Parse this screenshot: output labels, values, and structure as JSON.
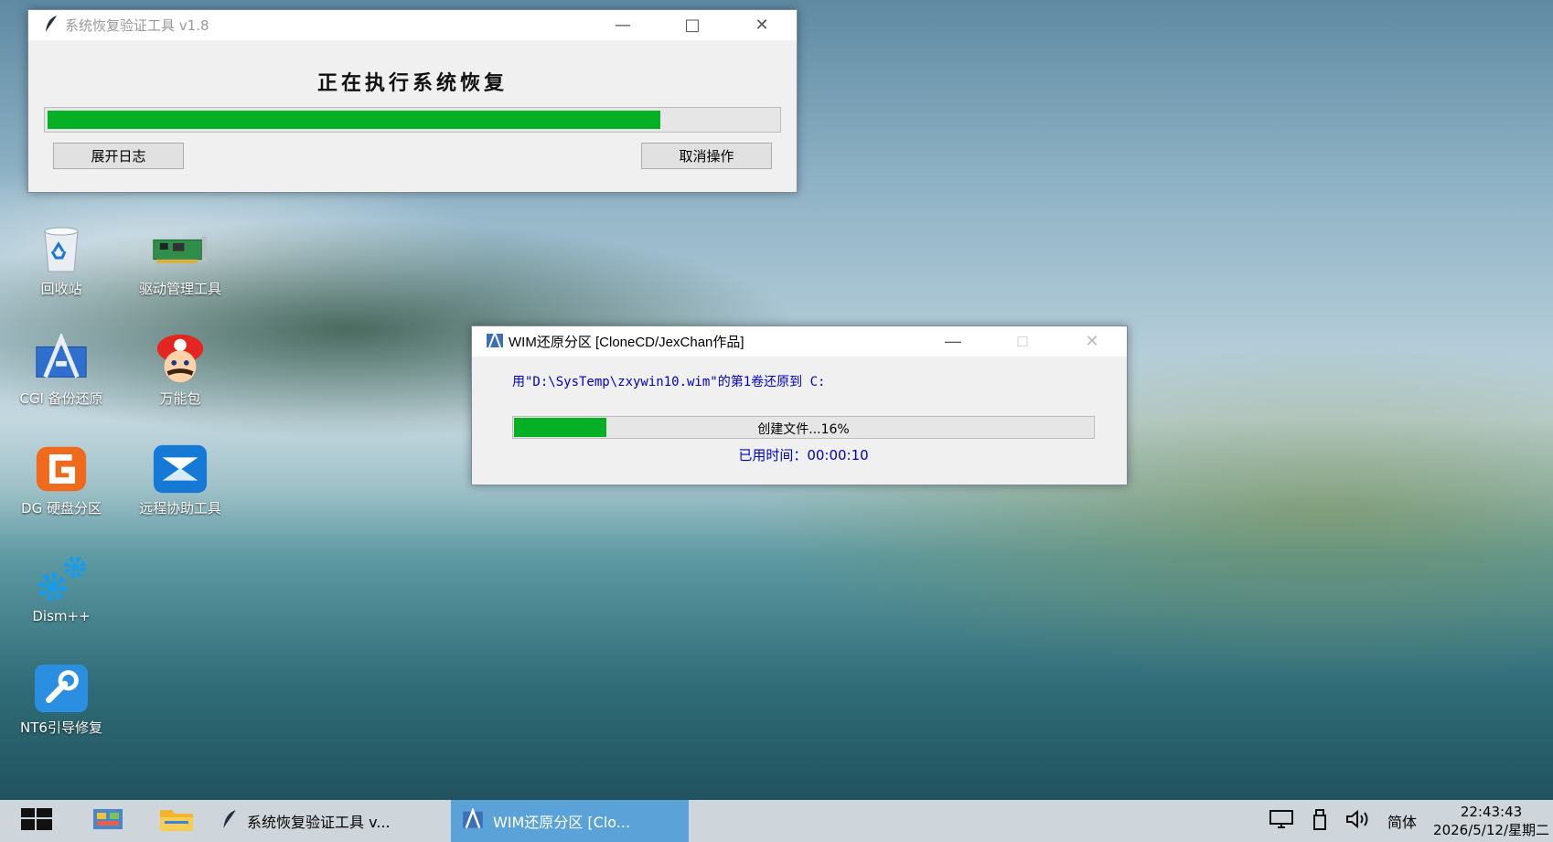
{
  "desktop_icons": [
    {
      "label": "回收站",
      "icon": "recycle-bin-icon"
    },
    {
      "label": "驱动管理工具",
      "icon": "network-card-icon"
    },
    {
      "label": "CGI 备份还原",
      "icon": "cgi-icon"
    },
    {
      "label": "万能包",
      "icon": "mario-icon"
    },
    {
      "label": "DG 硬盘分区",
      "icon": "diskgenius-icon"
    },
    {
      "label": "远程协助工具",
      "icon": "remote-assist-icon"
    },
    {
      "label": "Dism++",
      "icon": "gears-icon"
    },
    {
      "label": "NT6引导修复",
      "icon": "wrench-icon"
    }
  ],
  "recovery_window": {
    "title": "系统恢复验证工具 v1.8",
    "heading": "正在执行系统恢复",
    "progress": 0.84,
    "expand_log_label": "展开日志",
    "cancel_label": "取消操作"
  },
  "wim_window": {
    "title": "WIM还原分区  [CloneCD/JexChan作品]",
    "message": "用\"D:\\SysTemp\\zxywin10.wim\"的第1卷还原到 C:",
    "progress": 0.16,
    "progress_text": "创建文件...16%",
    "elapsed": "已用时间：00:00:10"
  },
  "taskbar": {
    "tasks": [
      {
        "label": "系统恢复验证工具 v...",
        "active": false
      },
      {
        "label": "WIM还原分区  [Clo...",
        "active": true
      }
    ],
    "ime": "简体",
    "time": "22:43:43",
    "date": "2026/5/12/星期二"
  },
  "colors": {
    "progress_green": "#06b025",
    "wim_text_blue": "#0000cc",
    "active_task": "#5aa2d8"
  }
}
